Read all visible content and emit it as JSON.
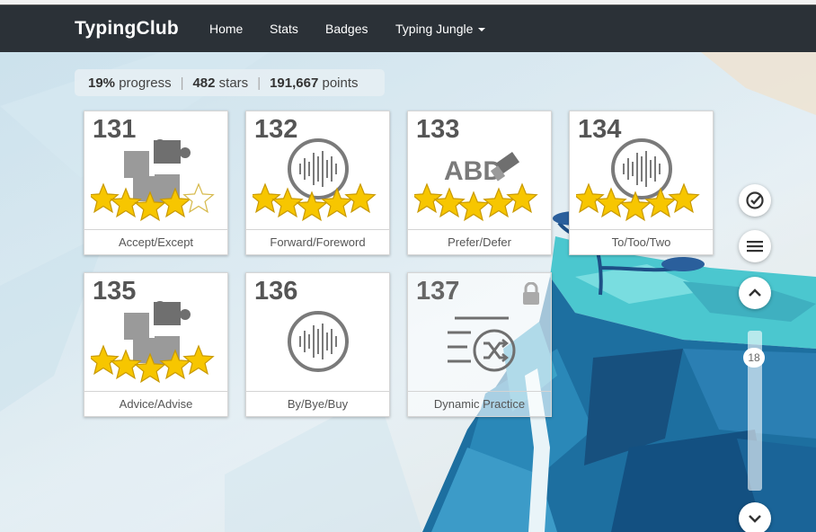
{
  "navbar": {
    "brand": "TypingClub",
    "links": [
      "Home",
      "Stats",
      "Badges",
      "Typing Jungle"
    ]
  },
  "progress": {
    "percent": "19%",
    "percent_label": "progress",
    "stars": "482",
    "stars_label": "stars",
    "points": "191,667",
    "points_label": "points"
  },
  "lessons": [
    {
      "number": "131",
      "title": "Accept/Except",
      "icon": "puzzle-icon",
      "stars": 4,
      "locked": false
    },
    {
      "number": "132",
      "title": "Forward/Foreword",
      "icon": "audio-wave-icon",
      "stars": 5,
      "locked": false
    },
    {
      "number": "133",
      "title": "Prefer/Defer",
      "icon": "eraser-text-icon",
      "stars": 5,
      "locked": false
    },
    {
      "number": "134",
      "title": "To/Too/Two",
      "icon": "audio-wave-icon",
      "stars": 5,
      "locked": false
    },
    {
      "number": "135",
      "title": "Advice/Advise",
      "icon": "puzzle-icon",
      "stars": 5,
      "locked": false
    },
    {
      "number": "136",
      "title": "By/Bye/Buy",
      "icon": "audio-wave-icon",
      "stars": 0,
      "locked": false
    },
    {
      "number": "137",
      "title": "Dynamic Practice",
      "icon": "shuffle-list-icon",
      "stars": 0,
      "locked": true
    }
  ],
  "sidebar": {
    "scroll_value": "18",
    "buttons": [
      "check-badge-icon",
      "menu-icon",
      "chevron-up-icon",
      "chevron-down-icon"
    ]
  },
  "colors": {
    "navbar": "#2b3137",
    "star_fill": "#f7c600",
    "icon_gray": "#7a7a7a"
  }
}
